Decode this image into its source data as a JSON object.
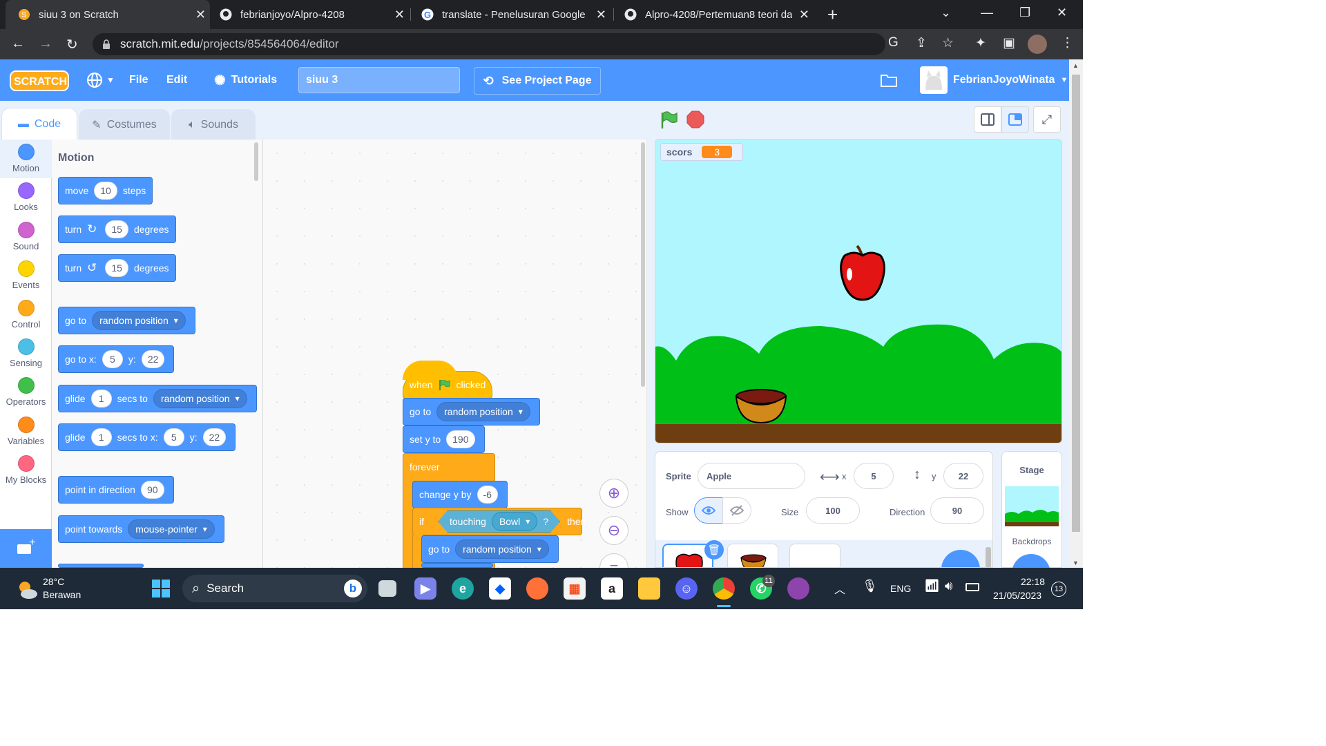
{
  "browser": {
    "tabs": [
      {
        "title": "siuu 3 on Scratch",
        "active": true
      },
      {
        "title": "febrianjoyo/Alpro-4208",
        "active": false
      },
      {
        "title": "translate - Penelusuran Google",
        "active": false
      },
      {
        "title": "Alpro-4208/Pertemuan8 teori da",
        "active": false
      }
    ],
    "new_tab": "+",
    "url_host": "scratch.mit.edu",
    "url_path": "/projects/854564064/editor"
  },
  "menubar": {
    "logo": "SCRATCH",
    "file": "File",
    "edit": "Edit",
    "tutorials": "Tutorials",
    "project_title": "siuu 3",
    "see_project": "See Project Page",
    "username": "FebrianJoyoWinata"
  },
  "editor_tabs": {
    "code": "Code",
    "costumes": "Costumes",
    "sounds": "Sounds"
  },
  "categories": [
    {
      "label": "Motion",
      "color": "#4c97ff"
    },
    {
      "label": "Looks",
      "color": "#9966ff"
    },
    {
      "label": "Sound",
      "color": "#cf63cf"
    },
    {
      "label": "Events",
      "color": "#ffd500"
    },
    {
      "label": "Control",
      "color": "#ffab19"
    },
    {
      "label": "Sensing",
      "color": "#4cbfe6"
    },
    {
      "label": "Operators",
      "color": "#40bf4a"
    },
    {
      "label": "Variables",
      "color": "#ff8c1a"
    },
    {
      "label": "My Blocks",
      "color": "#ff6680"
    }
  ],
  "palette": {
    "section": "Motion",
    "move": {
      "a": "move",
      "v": "10",
      "b": "steps"
    },
    "turn_cw": {
      "a": "turn",
      "v": "15",
      "b": "degrees"
    },
    "turn_ccw": {
      "a": "turn",
      "v": "15",
      "b": "degrees"
    },
    "goto": {
      "a": "go to",
      "dd": "random position"
    },
    "gotoxy": {
      "a": "go to x:",
      "x": "5",
      "b": "y:",
      "y": "22"
    },
    "glide": {
      "a": "glide",
      "v": "1",
      "b": "secs to",
      "dd": "random position"
    },
    "glidexy": {
      "a": "glide",
      "v": "1",
      "b": "secs to x:",
      "x": "5",
      "c": "y:",
      "y": "22"
    },
    "point_dir": {
      "a": "point in direction",
      "v": "90"
    },
    "point_towards": {
      "a": "point towards",
      "dd": "mouse-pointer"
    }
  },
  "script": {
    "hat": {
      "a": "when",
      "b": "clicked"
    },
    "goto": {
      "a": "go to",
      "dd": "random position"
    },
    "sety": {
      "a": "set y to",
      "v": "190"
    },
    "forever": "forever",
    "changey": {
      "a": "change y by",
      "v": "-6"
    },
    "if": {
      "a": "if",
      "b": "then"
    },
    "touching": {
      "a": "touching",
      "dd": "Bowl",
      "q": "?"
    },
    "inner_goto": {
      "a": "go to",
      "dd": "random position"
    }
  },
  "stage": {
    "monitor_label": "scors",
    "monitor_value": "3"
  },
  "sprite_info": {
    "sprite_label": "Sprite",
    "sprite_name": "Apple",
    "x_label": "x",
    "x": "5",
    "y_label": "y",
    "y": "22",
    "show_label": "Show",
    "size_label": "Size",
    "size": "100",
    "direction_label": "Direction",
    "direction": "90"
  },
  "stage_panel": {
    "title": "Stage",
    "backdrops": "Backdrops"
  },
  "taskbar": {
    "temp": "28°C",
    "weather": "Berawan",
    "search": "Search",
    "lang": "ENG",
    "time": "22:18",
    "date": "21/05/2023",
    "notif_count": "13",
    "whatsapp_badge": "11"
  }
}
